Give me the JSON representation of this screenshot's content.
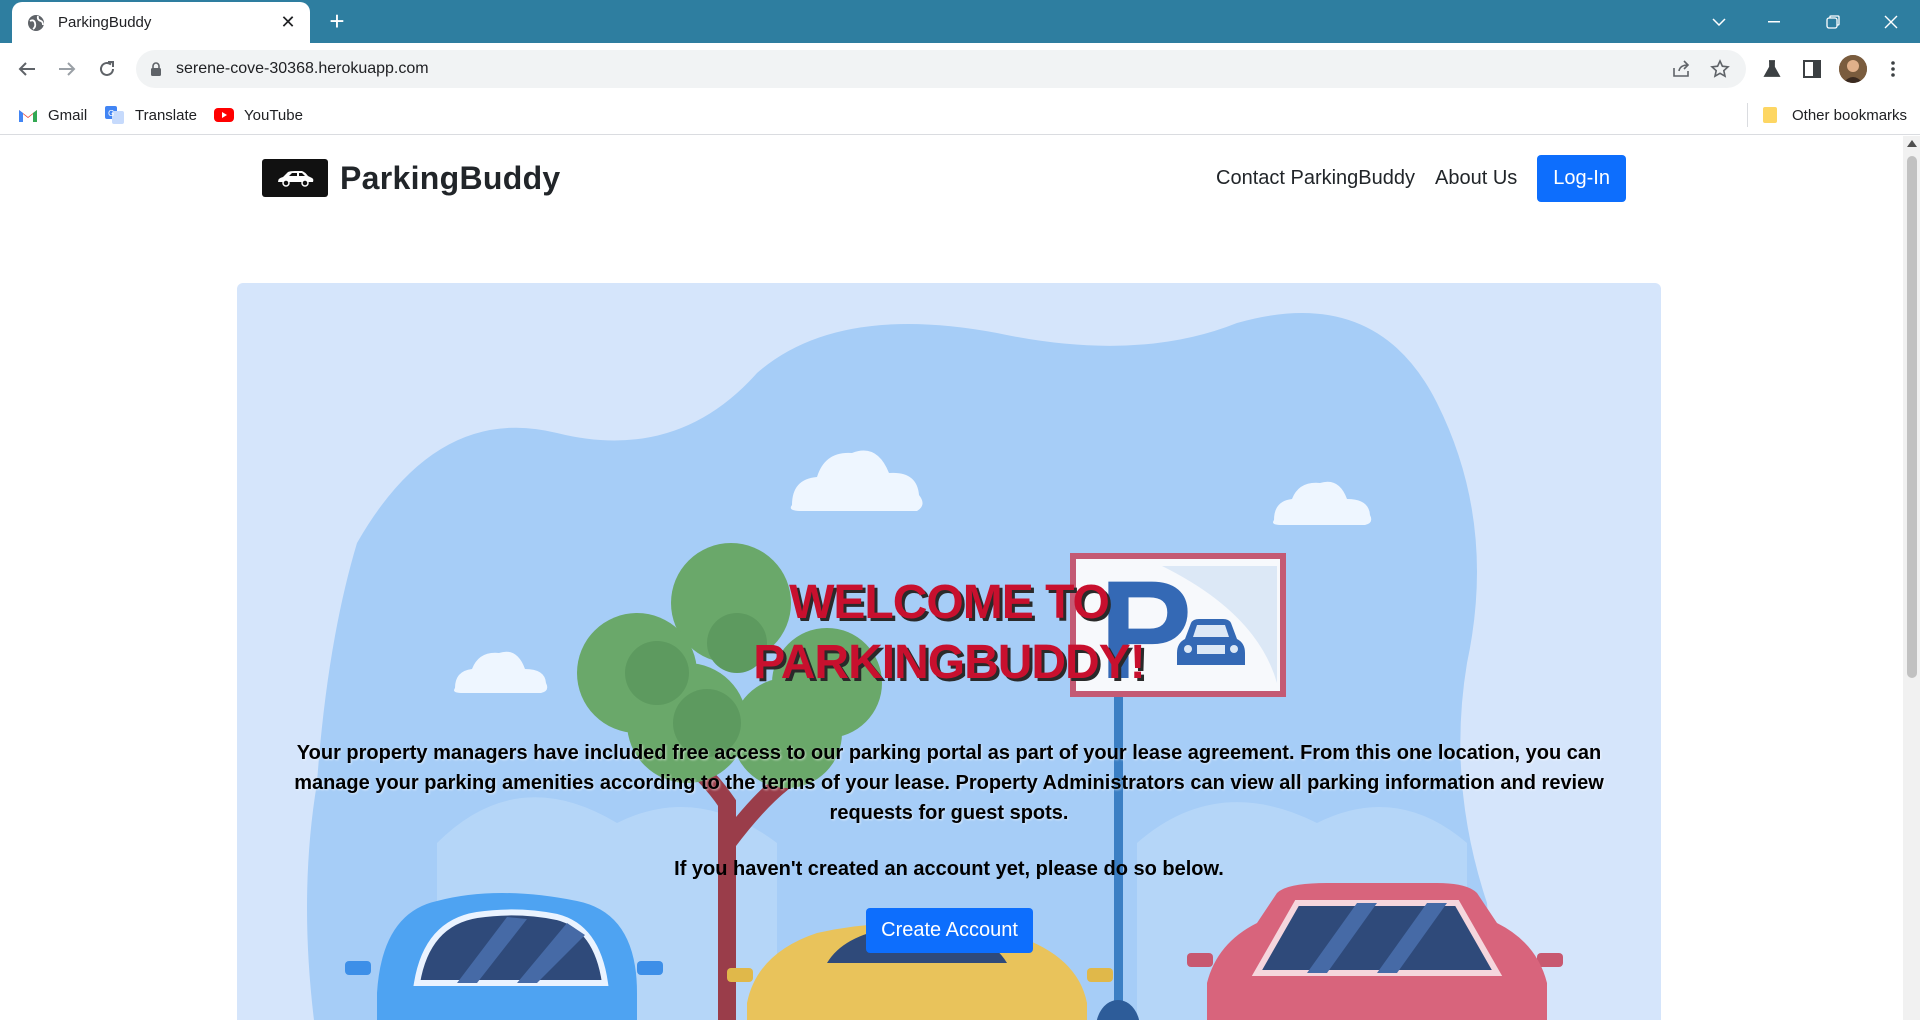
{
  "browser": {
    "tab_title": "ParkingBuddy",
    "url": "serene-cove-30368.herokuapp.com",
    "bookmarks": [
      {
        "label": "Gmail",
        "icon": "gmail-icon"
      },
      {
        "label": "Translate",
        "icon": "translate-icon"
      },
      {
        "label": "YouTube",
        "icon": "youtube-icon"
      }
    ],
    "other_bookmarks": "Other bookmarks"
  },
  "site": {
    "brand": "ParkingBuddy",
    "nav": {
      "contact": "Contact ParkingBuddy",
      "about": "About Us",
      "login": "Log-In"
    }
  },
  "hero": {
    "title_line1": "WELCOME TO",
    "title_line2": "PARKINGBUDDY!",
    "paragraph": "Your property managers have included free access to our parking portal as part of your lease agreement. From this one location, you can manage your parking amenities according to the terms of your lease. Property Administrators can view all parking information and review requests for guest spots.",
    "prompt": "If you haven't created an account yet, please do so below.",
    "cta": "Create Account"
  },
  "colors": {
    "browser_frame": "#2e7ea0",
    "primary": "#0d6efd",
    "title_red": "#c8102e"
  }
}
